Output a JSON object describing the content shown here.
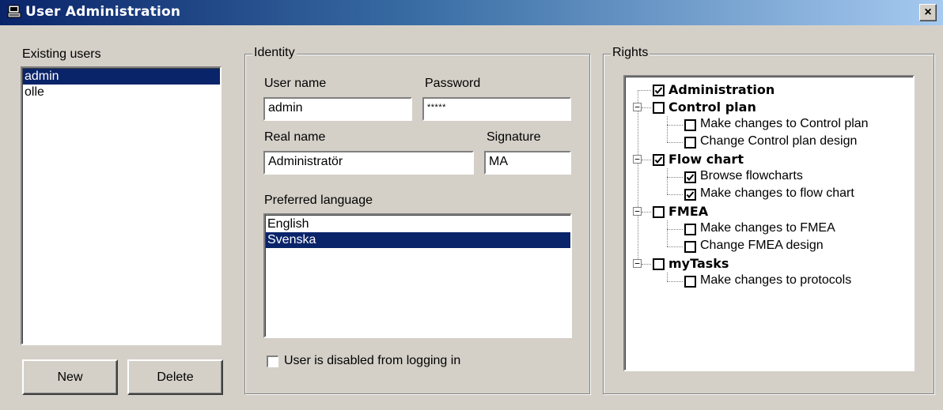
{
  "window": {
    "title": "User Administration",
    "close": "×"
  },
  "users": {
    "label": "Existing users",
    "items": [
      {
        "name": "admin",
        "selected": true
      },
      {
        "name": "olle",
        "selected": false
      }
    ],
    "new_label": "New",
    "delete_label": "Delete"
  },
  "identity": {
    "legend": "Identity",
    "username_label": "User name",
    "username_value": "admin",
    "password_label": "Password",
    "password_value": "*****",
    "realname_label": "Real name",
    "realname_value": "Administratör",
    "signature_label": "Signature",
    "signature_value": "MA",
    "language_label": "Preferred language",
    "languages": [
      {
        "name": "English",
        "selected": false
      },
      {
        "name": "Svenska",
        "selected": true
      }
    ],
    "disabled_label": "User is disabled from logging in",
    "disabled_checked": false
  },
  "rights": {
    "legend": "Rights",
    "tree": [
      {
        "label": "Administration",
        "checked": true,
        "bold": true,
        "children": []
      },
      {
        "label": "Control plan",
        "checked": false,
        "bold": true,
        "expanded": true,
        "children": [
          {
            "label": "Make changes to Control plan",
            "checked": false
          },
          {
            "label": "Change Control plan design",
            "checked": false
          }
        ]
      },
      {
        "label": "Flow chart",
        "checked": true,
        "bold": true,
        "expanded": true,
        "children": [
          {
            "label": "Browse flowcharts",
            "checked": true
          },
          {
            "label": "Make changes to flow chart",
            "checked": true
          }
        ]
      },
      {
        "label": "FMEA",
        "checked": false,
        "bold": true,
        "expanded": true,
        "children": [
          {
            "label": "Make changes to FMEA",
            "checked": false
          },
          {
            "label": "Change FMEA design",
            "checked": false
          }
        ]
      },
      {
        "label": "myTasks",
        "checked": false,
        "bold": true,
        "expanded": true,
        "children": [
          {
            "label": "Make changes to protocols",
            "checked": false
          }
        ]
      }
    ]
  },
  "colors": {
    "selection": "#0a246a",
    "face": "#d4d0c8"
  }
}
